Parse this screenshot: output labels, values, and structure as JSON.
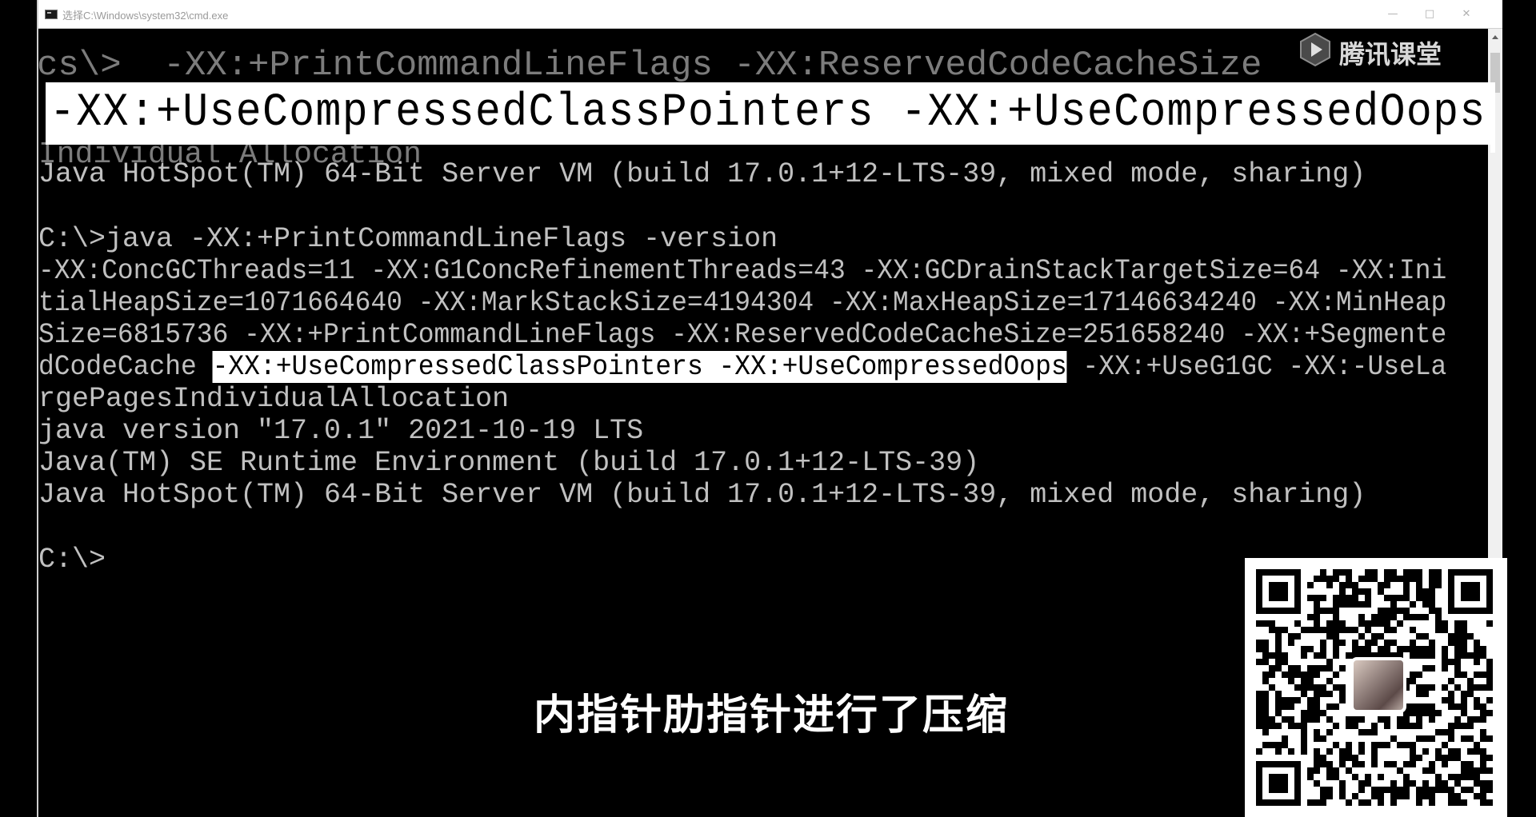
{
  "window": {
    "title": "选择C:\\Windows\\system32\\cmd.exe",
    "minimize_glyph": "—",
    "maximize_glyph": "□",
    "close_glyph": "✕"
  },
  "zoom_banner": {
    "text": "-XX:+UseCompressedClassPointers -XX:+UseCompressedOops"
  },
  "console": {
    "partial_top": "cs\\>  -XX:+PrintCommandLineFlags -XX:ReservedCodeCacheSize",
    "partial_under": "Individual Allocation",
    "line_hotspot_1": "Java HotSpot(TM) 64-Bit Server VM (build 17.0.1+12-LTS-39, mixed mode, sharing)",
    "command": "C:\\>java -XX:+PrintCommandLineFlags -version",
    "flags_1": "-XX:ConcGCThreads=11 -XX:G1ConcRefinementThreads=43 -XX:GCDrainStackTargetSize=64 -XX:Ini",
    "flags_2": "tialHeapSize=1071664640 -XX:MarkStackSize=4194304 -XX:MaxHeapSize=17146634240 -XX:MinHeap",
    "flags_3": "Size=6815736 -XX:+PrintCommandLineFlags -XX:ReservedCodeCacheSize=251658240 -XX:+Segmente",
    "flags_4_pre": "dCodeCache ",
    "flags_4_hl": "-XX:+UseCompressedClassPointers -XX:+UseCompressedOops",
    "flags_4_post": " -XX:+UseG1GC -XX:-UseLa",
    "flags_5": "rgePagesIndividualAllocation",
    "version": "java version \"17.0.1\" 2021-10-19 LTS",
    "runtime": "Java(TM) SE Runtime Environment (build 17.0.1+12-LTS-39)",
    "line_hotspot_2": "Java HotSpot(TM) 64-Bit Server VM (build 17.0.1+12-LTS-39, mixed mode, sharing)",
    "prompt": "C:\\>"
  },
  "watermark": {
    "text": "腾讯课堂"
  },
  "caption": {
    "text": "内指针肋指针进行了压缩"
  },
  "colors": {
    "console_text": "#c0c0c0",
    "console_bg": "#000000",
    "highlight_bg": "#ffffff"
  }
}
